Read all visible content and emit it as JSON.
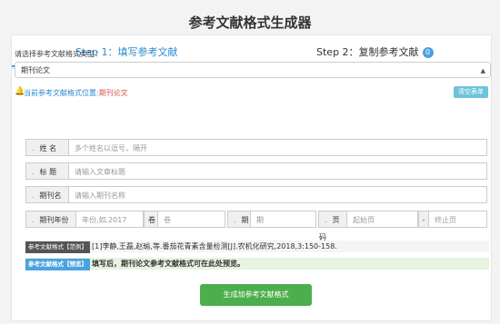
{
  "title": "参考文献格式生成器",
  "tabs": [
    {
      "label": "Step 1：填写参考文献"
    },
    {
      "label": "Step 2：复制参考文献",
      "badge": "0"
    }
  ],
  "type_label": "请选择参考文献格式类型：",
  "type_value": "期刊论文",
  "hint_prefix": "当前参考文献格式位置:",
  "hint_value": "期刊论文",
  "clear_label": "清空表单",
  "fields": {
    "author_label": "姓 名",
    "author_placeholder": "多个姓名以逗号，隔开",
    "title_label": "标 题",
    "title_placeholder": "请输入文章标题",
    "journal_label": "期刊名",
    "journal_placeholder": "请输入期刊名称",
    "year_label": "期刊年份",
    "year_placeholder": "年份,如,2017",
    "volume_label": "卷",
    "volume_placeholder": "卷",
    "issue_label": "期",
    "issue_placeholder": "期",
    "pages_label": "页码",
    "pages_start": "起始页",
    "pages_end": "终止页"
  },
  "example_tag": "参考文献格式【范例】",
  "example_text": "[1]李静,王磊,赵瑜,等.番茄花青素含量检测[J].农机化研究,2018,3:150-158.",
  "preview_tag": "参考文献格式【预览】",
  "preview_text": "填写后，期刊论文参考文献格式可在此处预览。",
  "generate_label": "生成加参考文献格式"
}
